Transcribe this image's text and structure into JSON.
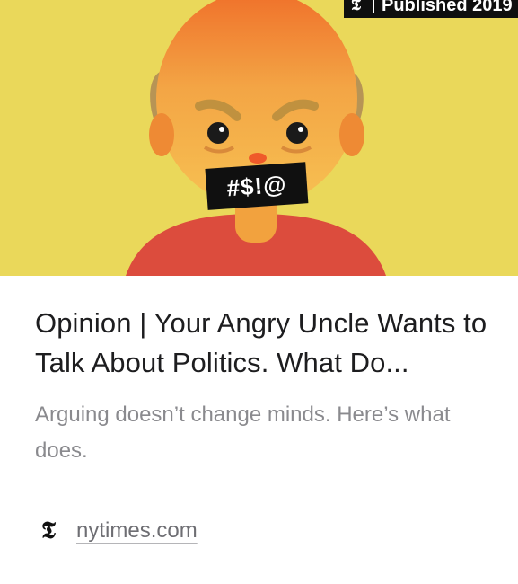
{
  "hero": {
    "badge_logo": "𝕿",
    "badge_text": "Published 2019",
    "censor_text": "#$!@",
    "colors": {
      "background": "#ead85a",
      "face": "#f2a23e",
      "face_top": "#f07a2a",
      "hair": "#b79455",
      "shirt": "#dc4c3d"
    }
  },
  "article": {
    "title": "Opinion | Your Angry Uncle Wants to Talk About Politics. What Do...",
    "description": "Arguing doesn’t change minds. Here’s what does."
  },
  "source": {
    "logo_icon": "nyt-logo-icon",
    "logo_glyph": "𝕿",
    "domain": "nytimes.com"
  }
}
